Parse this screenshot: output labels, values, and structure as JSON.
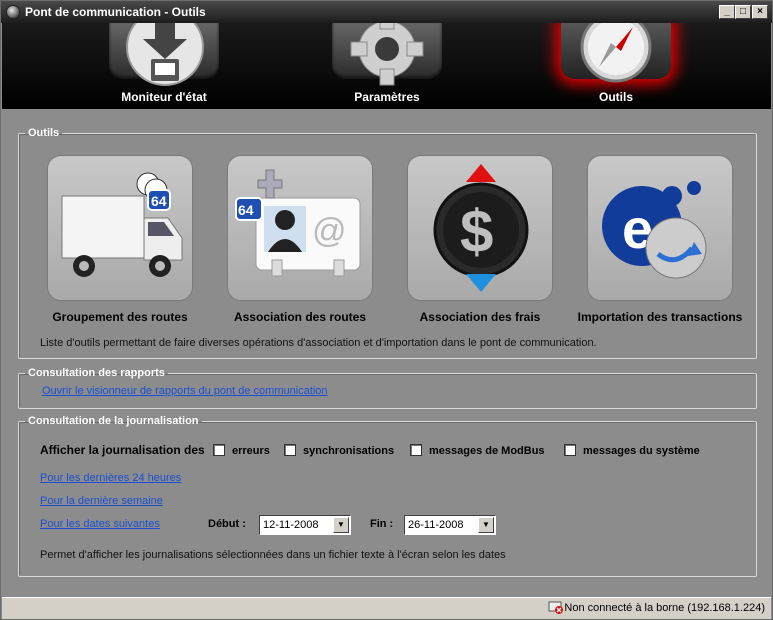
{
  "window": {
    "title": "Pont de communication - Outils"
  },
  "tabs": [
    {
      "label": "Moniteur d'état",
      "selected": false
    },
    {
      "label": "Paramètres",
      "selected": false
    },
    {
      "label": "Outils",
      "selected": true
    }
  ],
  "outils": {
    "legend": "Outils",
    "tools": [
      {
        "label": "Groupement des routes",
        "icon": "truck-icon"
      },
      {
        "label": "Association des routes",
        "icon": "contact-card-icon"
      },
      {
        "label": "Association des frais",
        "icon": "dollar-icon"
      },
      {
        "label": "Importation des transactions",
        "icon": "e-import-icon"
      }
    ],
    "description": "Liste d'outils permettant de faire diverses opérations d'association et d'importation dans le pont de communication."
  },
  "rapports": {
    "legend": "Consultation des rapports",
    "link": "Ouvrir le visionneur de rapports du pont de communication"
  },
  "journal": {
    "legend": "Consultation de la journalisation",
    "show_label": "Afficher la journalisation des",
    "checks": [
      "erreurs",
      "synchronisations",
      "messages de ModBus",
      "messages du système"
    ],
    "link_24h": "Pour les dernières 24 heures",
    "link_week": "Pour la dernière semaine",
    "link_dates": "Pour les dates suivantes",
    "start_label": "Début :",
    "start_value": "12-11-2008",
    "end_label": "Fin :",
    "end_value": "26-11-2008",
    "description": "Permet d'afficher les journalisations sélectionnées dans un fichier texte à l'écran selon les dates"
  },
  "status": {
    "text": "Non connecté à la borne (192.168.1.224)"
  },
  "colors": {
    "accent_red": "#dd0000",
    "link": "#1a4fd4",
    "panel": "#8c8c8c"
  }
}
